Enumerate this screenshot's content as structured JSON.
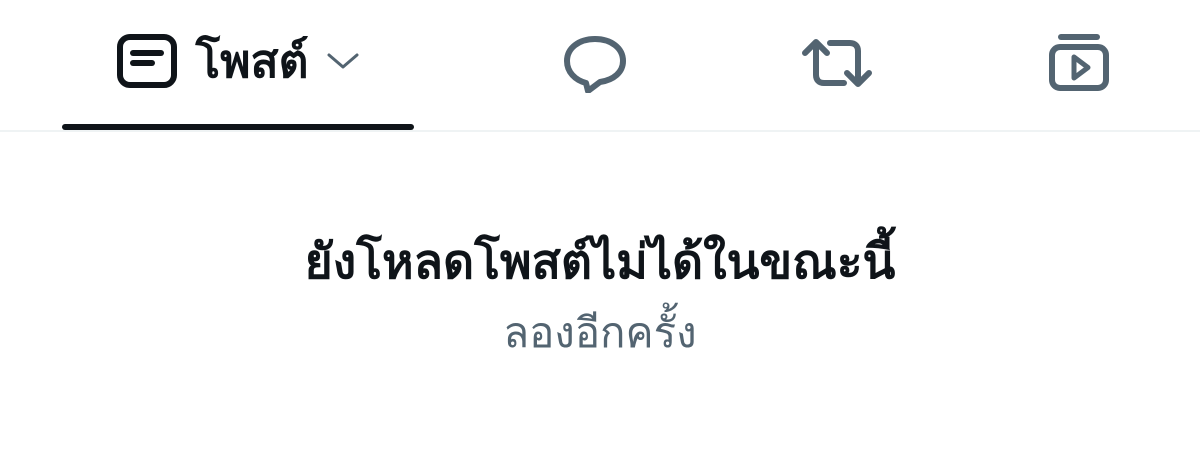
{
  "tabs": {
    "posts": {
      "label": "โพสต์",
      "icon": "post-icon",
      "selected": true,
      "dropdown_icon": "chevron-down-icon"
    },
    "replies": {
      "icon": "reply-bubble-icon"
    },
    "reposts": {
      "icon": "repost-icon"
    },
    "videos": {
      "icon": "video-icon"
    }
  },
  "error": {
    "message": "ยังโหลดโพสต์ไม่ได้ในขณะนี้",
    "retry_label": "ลองอีกครั้ง"
  },
  "colors": {
    "text_primary": "#0f1419",
    "text_secondary": "#536471",
    "icon_inactive": "#536471",
    "divider": "#eff3f4"
  }
}
